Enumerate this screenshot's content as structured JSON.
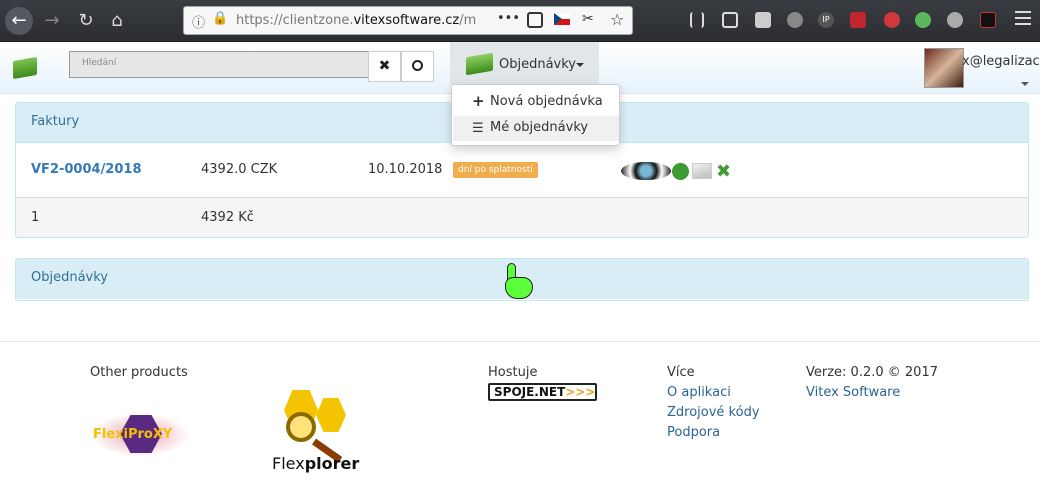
{
  "browser": {
    "url_prefix": "https://clientzone.",
    "url_domain": "vitexsoftware.cz",
    "url_suffix": "/m",
    "more_dots": "•••"
  },
  "navbar": {
    "search_placeholder": "Hledání",
    "clear_icon": "times-icon",
    "search_icon": "search-icon",
    "menu_label": "Objednávky",
    "user_label": "x@legalizace",
    "dropdown": [
      {
        "label": "Nová objednávka",
        "icon": "plus-icon"
      },
      {
        "label": "Mé objednávky",
        "icon": "list-icon"
      }
    ]
  },
  "invoices_panel": {
    "title": "Faktury",
    "row": {
      "number": "VF2-0004/2018",
      "amount": "4392.0 CZK",
      "date": "10.10.2018",
      "status": "dní po splatnosti"
    },
    "summary": {
      "count": "1",
      "total": "4392 Kč"
    }
  },
  "orders_panel": {
    "title": "Objednávky"
  },
  "footer": {
    "other_products": "Other products",
    "flexiproxy": "FlexiProXY",
    "flexplorer_a": "Flex",
    "flexplorer_b": "plorer",
    "hosting_label": "Hostuje",
    "hosting_brand": "SPOJE.NET",
    "hosting_arrows": ">>>",
    "more_label": "Více",
    "links": [
      "O aplikaci",
      "Zdrojové kódy",
      "Podpora"
    ],
    "version": "Verze: 0.2.0 © 2017",
    "company": "Vitex Software"
  },
  "colors": {
    "accent": "#337ab7",
    "panel_head": "#d9edf7",
    "warning": "#f0ad4e"
  }
}
